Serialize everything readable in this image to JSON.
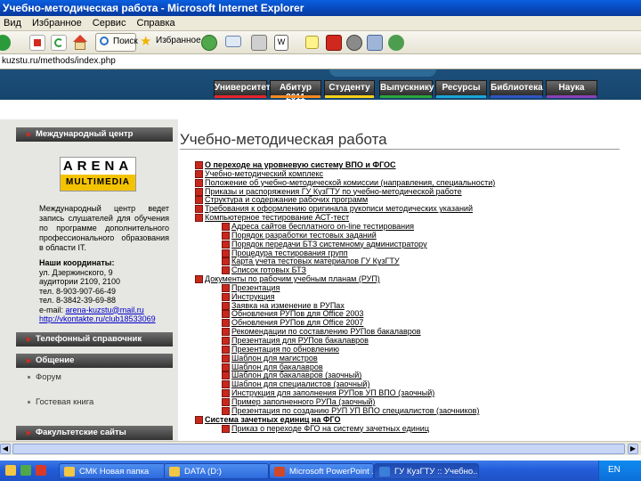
{
  "window": {
    "title": "Учебно-методическая работа - Microsoft Internet Explorer"
  },
  "menu": [
    "Вид",
    "Избранное",
    "Сервис",
    "Справка"
  ],
  "toolbar": {
    "search_label": "Поиск",
    "favorites_label": "Избранное",
    "icons": [
      "back-icon",
      "stop-icon",
      "refresh-icon",
      "home-icon",
      "search-icon",
      "favorites-icon",
      "history-icon",
      "mail-icon",
      "print-icon",
      "edit-icon",
      "notes-icon",
      "adobe-icon",
      "research-icon",
      "messenger-icon"
    ]
  },
  "address": {
    "url": "kuzstu.ru/methods/index.php"
  },
  "site_nav": [
    {
      "label": "Университет",
      "color": "#e8242a"
    },
    {
      "label": "Абитур 2011",
      "color": "#f58a1f"
    },
    {
      "label": "Студенту",
      "color": "#f7d117"
    },
    {
      "label": "Выпускнику",
      "color": "#2aa63b"
    },
    {
      "label": "Ресурсы",
      "color": "#1aa6d8"
    },
    {
      "label": "Библиотека",
      "color": "#2f56c4"
    },
    {
      "label": "Наука",
      "color": "#8a3fb8"
    }
  ],
  "sidebar": {
    "intl_center": "Международный центр",
    "logo_top": "ARENA",
    "logo_bottom": "MULTIMEDIA",
    "description": "Международный центр ведет запись слушателей для обучения по программе дополнительного профессионального образования в области IT.",
    "contacts_heading": "Наши координаты:",
    "contact_lines": [
      "ул. Дзержинского, 9",
      "аудитории 2109, 2100",
      "тел. 8-903-907-66-49",
      "тел. 8-3842-39-69-88"
    ],
    "email_prefix": "e-mail:",
    "email": "arena-kuzstu@mail.ru",
    "vk": "http://vkontakte.ru/club18533069",
    "phonebook": "Телефонный справочник",
    "communication": "Общение",
    "forum": "Форум",
    "guestbook": "Гостевая книга",
    "faculty_sites": "Факультетские сайты"
  },
  "main": {
    "title": "Учебно-методическая работа",
    "items": [
      {
        "text": "О переходе на уровневую систему ВПО и ФГОС",
        "level": 0,
        "bold": true
      },
      {
        "text": "Учебно-методический комплекс",
        "level": 0,
        "bold": false
      },
      {
        "text": "Положение об учебно-методической комиссии (направления, специальности)",
        "level": 0,
        "bold": false
      },
      {
        "text": "Приказы и распоряжения ГУ КузГТУ по учебно-методической работе",
        "level": 0,
        "bold": false
      },
      {
        "text": "Структура и содержание рабочих программ",
        "level": 0,
        "bold": false
      },
      {
        "text": "Требования к оформлению оригинала рукописи методических указаний",
        "level": 0,
        "bold": false
      },
      {
        "text": "Компьютерное тестирование АСТ-тест",
        "level": 0,
        "bold": false
      },
      {
        "text": "Адреса сайтов бесплатного on-line тестирования",
        "level": 1,
        "bold": false
      },
      {
        "text": "Порядок разработки тестовых заданий",
        "level": 1,
        "bold": false
      },
      {
        "text": "Порядок передачи БТЗ системному администратору",
        "level": 1,
        "bold": false
      },
      {
        "text": "Процедура тестирования групп",
        "level": 1,
        "bold": false
      },
      {
        "text": "Карта учета тестовых материалов ГУ КузГТУ",
        "level": 1,
        "bold": false
      },
      {
        "text": "Список готовых БТЗ",
        "level": 1,
        "bold": false
      },
      {
        "text": "Документы по рабочим учебным планам (РУП)",
        "level": 0,
        "bold": false
      },
      {
        "text": "Презентация",
        "level": 1,
        "bold": false
      },
      {
        "text": "Инструкция",
        "level": 1,
        "bold": false
      },
      {
        "text": "Заявка на изменение в РУПах",
        "level": 1,
        "bold": false
      },
      {
        "text": "Обновления РУПов для Office 2003",
        "level": 1,
        "bold": false
      },
      {
        "text": "Обновления РУПов для Office 2007",
        "level": 1,
        "bold": false
      },
      {
        "text": "Рекомендации по составлению РУПов бакалавров",
        "level": 1,
        "bold": false
      },
      {
        "text": "Презентация для РУПов бакалавров",
        "level": 1,
        "bold": false
      },
      {
        "text": "Презентация по обновлению",
        "level": 1,
        "bold": false
      },
      {
        "text": "Шаблон для магистров",
        "level": 1,
        "bold": false
      },
      {
        "text": "Шаблон для бакалавров",
        "level": 1,
        "bold": false
      },
      {
        "text": "Шаблон для бакалавров (заочный)",
        "level": 1,
        "bold": false
      },
      {
        "text": "Шаблон для специалистов (заочный)",
        "level": 1,
        "bold": false
      },
      {
        "text": "Инструкция для заполнения РУПов УП ВПО (заочный)",
        "level": 1,
        "bold": false
      },
      {
        "text": "Пример заполненного РУПа (заочный)",
        "level": 1,
        "bold": false
      },
      {
        "text": "Презентация по созданию РУП УП ВПО специалистов (заочников)",
        "level": 1,
        "bold": false
      },
      {
        "text": "Система зачетных единиц на ФГО",
        "level": 0,
        "bold": true
      },
      {
        "text": "Приказ о переходе ФГО на систему зачетных единиц",
        "level": 1,
        "bold": false
      }
    ]
  },
  "taskbar": {
    "buttons": [
      {
        "label": "СМК Новая папка",
        "icon_color": "#f3c644"
      },
      {
        "label": "DATA (D:)",
        "icon_color": "#f3c644"
      },
      {
        "label": "Microsoft PowerPoint ...",
        "icon_color": "#d24726"
      },
      {
        "label": "ГУ КузГТУ :: Учебно...",
        "icon_color": "#3c7fd9"
      }
    ],
    "lang": "EN"
  }
}
